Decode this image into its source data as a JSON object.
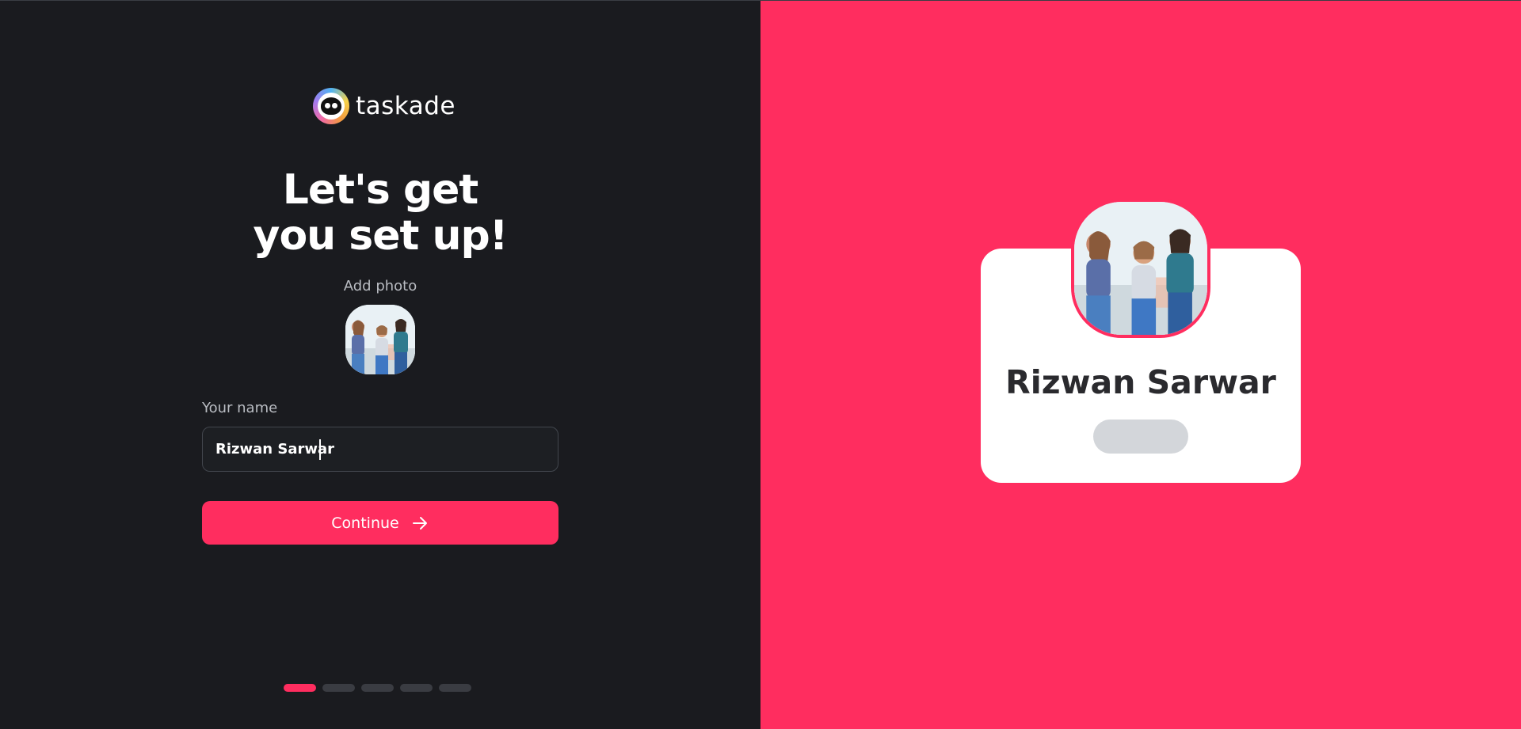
{
  "brand": {
    "name": "taskade",
    "logo_icon": "taskade-logo-icon",
    "accent_color": "#ff2d5f"
  },
  "onboarding": {
    "heading_line1": "Let's get",
    "heading_line2": "you set up!",
    "add_photo_label": "Add photo",
    "name_label": "Your name",
    "name_value": "Rizwan Sarwar",
    "continue_label": "Continue",
    "continue_icon": "arrow-right-icon",
    "progress": {
      "current_step": 1,
      "total_steps": 5
    }
  },
  "preview_card": {
    "name": "Rizwan Sarwar",
    "avatar_icon": "group-photo-avatar"
  }
}
